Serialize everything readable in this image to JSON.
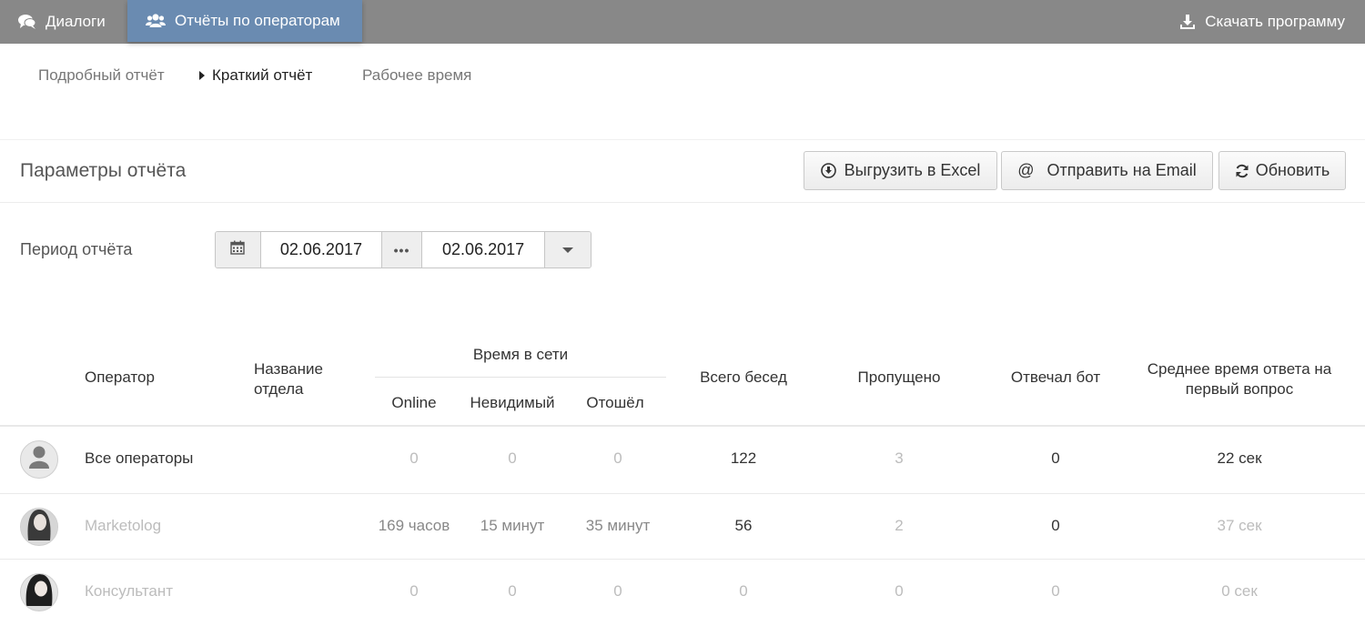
{
  "topbar": {
    "dialogs_label": "Диалоги",
    "reports_label": "Отчёты по операторам",
    "download_label": "Скачать программу",
    "bar_color": "#888888",
    "active_color": "#6a8bb1"
  },
  "subtabs": {
    "detailed": "Подробный отчёт",
    "short": "Краткий отчёт",
    "worktime": "Рабочее время"
  },
  "params": {
    "title": "Параметры отчёта",
    "excel_label": "Выгрузить в Excel",
    "email_label": "Отправить на Email",
    "refresh_label": "Обновить",
    "period_label": "Период отчёта",
    "date_from": "02.06.2017",
    "date_to": "02.06.2017"
  },
  "table": {
    "headers": {
      "operator": "Оператор",
      "department": "Название отдела",
      "online_time": "Время в сети",
      "online": "Online",
      "invisible": "Невидимый",
      "away": "Отошёл",
      "total": "Всего бесед",
      "missed": "Пропущено",
      "bot": "Отвечал бот",
      "avg_response": "Среднее время ответа на первый вопрос"
    },
    "rows": [
      {
        "name": "Все операторы",
        "online": "0",
        "invisible": "0",
        "away": "0",
        "total": "122",
        "missed": "3",
        "bot": "0",
        "avg": "22 сек"
      },
      {
        "name": "Marketolog",
        "online": "169 часов",
        "invisible": "15 минут",
        "away": "35 минут",
        "total": "56",
        "missed": "2",
        "bot": "0",
        "avg": "37 сек"
      },
      {
        "name": "Консультант",
        "online": "0",
        "invisible": "0",
        "away": "0",
        "total": "0",
        "missed": "0",
        "bot": "0",
        "avg": "0 сек"
      }
    ]
  }
}
